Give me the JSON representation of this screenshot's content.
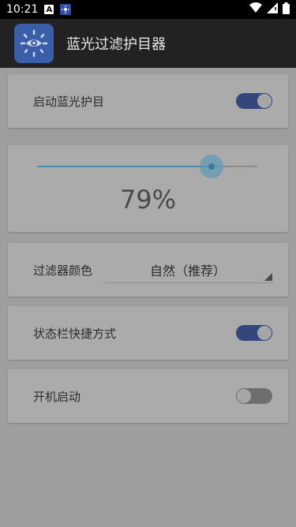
{
  "status_bar": {
    "time": "10:21",
    "notif_a": "A"
  },
  "app_bar": {
    "title": "蓝光过滤护目器"
  },
  "settings": {
    "enable_label": "启动蓝光护目",
    "enable_on": true,
    "slider_percent": 79,
    "slider_text": "79%",
    "filter_color_label": "过滤器颜色",
    "filter_color_value": "自然（推荐）",
    "statusbar_shortcut_label": "状态栏快捷方式",
    "statusbar_shortcut_on": true,
    "boot_start_label": "开机启动",
    "boot_start_on": false
  },
  "icons": {
    "app_icon": "eye-sun-icon",
    "wifi": "wifi-icon",
    "signal": "signal-icon",
    "battery": "battery-icon"
  },
  "colors": {
    "toggle_on": "#34477c",
    "slider_accent": "#4b8aa8",
    "background_dim": "#9e9e9e"
  }
}
